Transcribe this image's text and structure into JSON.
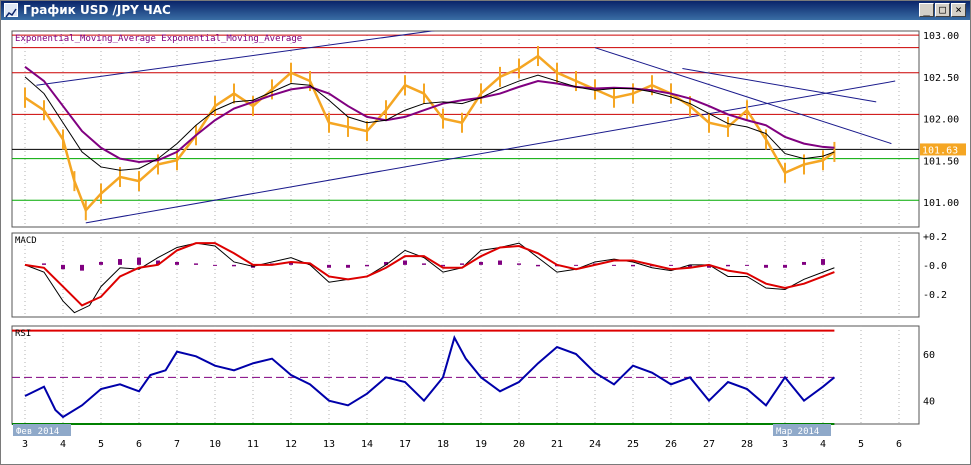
{
  "window": {
    "title": "График USD /JPY  ЧАС",
    "buttons": {
      "minimize": "_",
      "maximize": "□",
      "close": "×"
    }
  },
  "chart_data": {
    "type": "line",
    "title": "График USD /JPY ЧАС",
    "x_day_labels": [
      "3",
      "4",
      "5",
      "6",
      "7",
      "10",
      "11",
      "12",
      "13",
      "14",
      "17",
      "18",
      "19",
      "20",
      "21",
      "24",
      "25",
      "26",
      "27",
      "28",
      "3",
      "4",
      "5",
      "6"
    ],
    "x_month_labels": [
      {
        "text": "Фев 2014",
        "day_index": 0
      },
      {
        "text": "Мар 2014",
        "day_index": 20
      }
    ],
    "panels": [
      {
        "name": "price",
        "legend": "Exponential_Moving_Average Exponential_Moving_Average",
        "ylim": [
          100.7,
          103.05
        ],
        "yticks": [
          103.0,
          102.5,
          102.0,
          101.5,
          101.0
        ],
        "ytick_labels": [
          "103.00",
          "102.50",
          "102.00",
          "101.50",
          "101.00"
        ],
        "last_price": 101.63,
        "last_price_label": "101.63",
        "horizontal_levels": [
          {
            "value": 103.0,
            "color": "#cc0000"
          },
          {
            "value": 102.85,
            "color": "#cc0000"
          },
          {
            "value": 102.55,
            "color": "#cc0000"
          },
          {
            "value": 102.05,
            "color": "#cc0000"
          },
          {
            "value": 101.63,
            "color": "#000000"
          },
          {
            "value": 101.52,
            "color": "#00aa00"
          },
          {
            "value": 101.02,
            "color": "#00aa00"
          }
        ],
        "trend_lines": [
          {
            "from": [
              0.3,
              102.4
            ],
            "to": [
              11.5,
              103.1
            ]
          },
          {
            "from": [
              1.6,
              100.75
            ],
            "to": [
              22.9,
              102.45
            ]
          },
          {
            "from": [
              15.0,
              102.85
            ],
            "to": [
              22.8,
              101.7
            ]
          },
          {
            "from": [
              17.3,
              102.6
            ],
            "to": [
              22.4,
              102.2
            ]
          }
        ],
        "series": [
          {
            "kind": "price_hl",
            "color": "#f5a623",
            "x": [
              0.0,
              0.5,
              1.0,
              1.3,
              1.6,
              2.0,
              2.5,
              3.0,
              3.5,
              4.0,
              4.5,
              5.0,
              5.5,
              6.0,
              6.5,
              7.0,
              7.5,
              8.0,
              8.5,
              9.0,
              9.5,
              10.0,
              10.5,
              11.0,
              11.5,
              12.0,
              12.5,
              13.0,
              13.5,
              14.0,
              14.5,
              15.0,
              15.5,
              16.0,
              16.5,
              17.0,
              17.5,
              18.0,
              18.5,
              19.0,
              19.5,
              20.0,
              20.5,
              21.0,
              21.3
            ],
            "y": [
              102.25,
              102.1,
              101.75,
              101.25,
              100.9,
              101.1,
              101.3,
              101.25,
              101.45,
              101.5,
              101.8,
              102.15,
              102.3,
              102.15,
              102.35,
              102.55,
              102.45,
              101.95,
              101.9,
              101.85,
              102.1,
              102.4,
              102.3,
              102.0,
              101.95,
              102.3,
              102.5,
              102.6,
              102.75,
              102.55,
              102.45,
              102.35,
              102.25,
              102.3,
              102.4,
              102.3,
              102.15,
              101.95,
              101.9,
              102.1,
              101.75,
              101.35,
              101.45,
              101.5,
              101.6
            ]
          },
          {
            "kind": "ema",
            "name": "Exponential_Moving_Average",
            "color": "#800080",
            "x": [
              0.0,
              0.5,
              1.0,
              1.5,
              2.0,
              2.5,
              3.0,
              3.5,
              4.0,
              4.5,
              5.0,
              5.5,
              6.0,
              6.5,
              7.0,
              7.5,
              8.0,
              8.5,
              9.0,
              9.5,
              10.0,
              10.5,
              11.0,
              11.5,
              12.0,
              12.5,
              13.0,
              13.5,
              14.0,
              14.5,
              15.0,
              15.5,
              16.0,
              16.5,
              17.0,
              17.5,
              18.0,
              18.5,
              19.0,
              19.5,
              20.0,
              20.5,
              21.0,
              21.3
            ],
            "y": [
              102.62,
              102.45,
              102.15,
              101.85,
              101.65,
              101.52,
              101.48,
              101.5,
              101.6,
              101.8,
              101.98,
              102.12,
              102.2,
              102.28,
              102.35,
              102.38,
              102.3,
              102.15,
              102.02,
              101.98,
              102.02,
              102.1,
              102.18,
              102.22,
              102.25,
              102.3,
              102.38,
              102.45,
              102.42,
              102.38,
              102.36,
              102.37,
              102.36,
              102.34,
              102.3,
              102.24,
              102.15,
              102.05,
              101.98,
              101.92,
              101.78,
              101.7,
              101.66,
              101.65
            ]
          },
          {
            "kind": "ema",
            "name": "Exponential_Moving_Average",
            "color": "#000000",
            "x": [
              0.0,
              0.5,
              1.0,
              1.5,
              2.0,
              2.5,
              3.0,
              3.5,
              4.0,
              4.5,
              5.0,
              5.5,
              6.0,
              6.5,
              7.0,
              7.5,
              8.0,
              8.5,
              9.0,
              9.5,
              10.0,
              10.5,
              11.0,
              11.5,
              12.0,
              12.5,
              13.0,
              13.5,
              14.0,
              14.5,
              15.0,
              15.5,
              16.0,
              16.5,
              17.0,
              17.5,
              18.0,
              18.5,
              19.0,
              19.5,
              20.0,
              20.5,
              21.0,
              21.3
            ],
            "y": [
              102.5,
              102.3,
              101.95,
              101.6,
              101.42,
              101.38,
              101.4,
              101.52,
              101.7,
              101.92,
              102.1,
              102.2,
              102.22,
              102.32,
              102.42,
              102.4,
              102.22,
              102.02,
              101.95,
              101.98,
              102.1,
              102.18,
              102.2,
              102.18,
              102.25,
              102.36,
              102.45,
              102.52,
              102.45,
              102.38,
              102.34,
              102.36,
              102.36,
              102.32,
              102.26,
              102.18,
              102.06,
              101.94,
              101.9,
              101.82,
              101.58,
              101.52,
              101.55,
              101.6
            ]
          }
        ]
      },
      {
        "name": "macd",
        "legend": "MACD",
        "ylim": [
          -0.36,
          0.22
        ],
        "yticks": [
          0.2,
          0.0,
          -0.2
        ],
        "ytick_labels": [
          "+0.2",
          "-0.0",
          "-0.2"
        ],
        "series": [
          {
            "kind": "histogram",
            "color": "#800080",
            "x": [
              0.5,
              1.0,
              1.5,
              2.0,
              2.5,
              3.0,
              3.5,
              4.0,
              4.5,
              5.0,
              5.5,
              6.0,
              6.5,
              7.0,
              7.5,
              8.0,
              8.5,
              9.0,
              9.5,
              10.0,
              10.5,
              11.0,
              11.5,
              12.0,
              12.5,
              13.0,
              13.5,
              14.0,
              14.5,
              15.0,
              15.5,
              16.0,
              16.5,
              17.0,
              17.5,
              18.0,
              18.5,
              19.0,
              19.5,
              20.0,
              20.5,
              21.0
            ],
            "y": [
              0.01,
              -0.03,
              -0.04,
              0.02,
              0.04,
              0.05,
              0.03,
              0.02,
              0.01,
              0.0,
              -0.01,
              -0.02,
              0.01,
              0.02,
              0.01,
              -0.02,
              -0.02,
              -0.01,
              0.02,
              0.03,
              0.01,
              -0.01,
              0.01,
              0.02,
              0.03,
              0.01,
              -0.01,
              -0.01,
              0.0,
              0.01,
              0.0,
              -0.01,
              -0.01,
              0.0,
              -0.02,
              -0.02,
              -0.01,
              0.0,
              -0.02,
              -0.02,
              0.02,
              0.04
            ]
          },
          {
            "kind": "line",
            "name": "MACD",
            "color": "#000000",
            "x": [
              0.0,
              0.5,
              1.0,
              1.3,
              1.7,
              2.0,
              2.5,
              3.0,
              3.5,
              4.0,
              4.5,
              5.0,
              5.5,
              6.0,
              6.5,
              7.0,
              7.5,
              8.0,
              8.5,
              9.0,
              9.5,
              10.0,
              10.5,
              11.0,
              11.5,
              12.0,
              12.5,
              13.0,
              13.5,
              14.0,
              14.5,
              15.0,
              15.5,
              16.0,
              16.5,
              17.0,
              17.5,
              18.0,
              18.5,
              19.0,
              19.5,
              20.0,
              20.5,
              21.0,
              21.3
            ],
            "y": [
              0.0,
              -0.05,
              -0.25,
              -0.33,
              -0.28,
              -0.15,
              -0.02,
              -0.03,
              0.05,
              0.12,
              0.15,
              0.13,
              0.02,
              -0.01,
              0.02,
              0.05,
              0.0,
              -0.12,
              -0.1,
              -0.08,
              0.0,
              0.1,
              0.05,
              -0.05,
              -0.02,
              0.1,
              0.12,
              0.15,
              0.05,
              -0.05,
              -0.03,
              0.02,
              0.04,
              0.02,
              -0.02,
              -0.04,
              0.0,
              0.0,
              -0.08,
              -0.08,
              -0.16,
              -0.17,
              -0.1,
              -0.05,
              -0.02
            ]
          },
          {
            "kind": "line",
            "name": "Signal",
            "color": "#dd0000",
            "x": [
              0.0,
              0.5,
              1.0,
              1.5,
              2.0,
              2.5,
              3.0,
              3.5,
              4.0,
              4.5,
              5.0,
              5.5,
              6.0,
              6.5,
              7.0,
              7.5,
              8.0,
              8.5,
              9.0,
              9.5,
              10.0,
              10.5,
              11.0,
              11.5,
              12.0,
              12.5,
              13.0,
              13.5,
              14.0,
              14.5,
              15.0,
              15.5,
              16.0,
              16.5,
              17.0,
              17.5,
              18.0,
              18.5,
              19.0,
              19.5,
              20.0,
              20.5,
              21.0,
              21.3
            ],
            "y": [
              0.0,
              -0.02,
              -0.15,
              -0.28,
              -0.22,
              -0.08,
              -0.02,
              0.0,
              0.1,
              0.15,
              0.15,
              0.08,
              0.0,
              0.0,
              0.02,
              0.01,
              -0.08,
              -0.1,
              -0.08,
              -0.02,
              0.06,
              0.06,
              -0.02,
              -0.02,
              0.06,
              0.12,
              0.13,
              0.08,
              0.0,
              -0.03,
              0.0,
              0.03,
              0.03,
              0.0,
              -0.03,
              -0.02,
              0.0,
              -0.04,
              -0.06,
              -0.13,
              -0.16,
              -0.13,
              -0.08,
              -0.05
            ]
          }
        ]
      },
      {
        "name": "rsi",
        "legend": "RSI",
        "ylim": [
          30,
          72
        ],
        "yticks": [
          60,
          40
        ],
        "ytick_labels": [
          "60",
          "40"
        ],
        "levels": [
          {
            "value": 70,
            "color": "#dd0000"
          },
          {
            "value": 50,
            "color": "#800080",
            "dashed": true
          },
          {
            "value": 30,
            "color": "#008000"
          }
        ],
        "series": [
          {
            "kind": "line",
            "name": "RSI",
            "color": "#0000aa",
            "x": [
              0.0,
              0.5,
              0.8,
              1.0,
              1.5,
              2.0,
              2.5,
              3.0,
              3.3,
              3.7,
              4.0,
              4.5,
              5.0,
              5.5,
              6.0,
              6.5,
              7.0,
              7.5,
              8.0,
              8.5,
              9.0,
              9.5,
              10.0,
              10.5,
              11.0,
              11.3,
              11.6,
              12.0,
              12.5,
              13.0,
              13.5,
              14.0,
              14.5,
              15.0,
              15.5,
              16.0,
              16.5,
              17.0,
              17.5,
              18.0,
              18.5,
              19.0,
              19.5,
              20.0,
              20.5,
              21.0,
              21.3
            ],
            "y": [
              42,
              46,
              36,
              33,
              38,
              45,
              47,
              44,
              51,
              53,
              61,
              59,
              55,
              53,
              56,
              58,
              51,
              47,
              40,
              38,
              43,
              50,
              48,
              40,
              50,
              67,
              58,
              50,
              44,
              48,
              56,
              63,
              60,
              52,
              47,
              55,
              52,
              47,
              50,
              40,
              48,
              45,
              38,
              50,
              40,
              46,
              50
            ]
          }
        ]
      }
    ]
  }
}
